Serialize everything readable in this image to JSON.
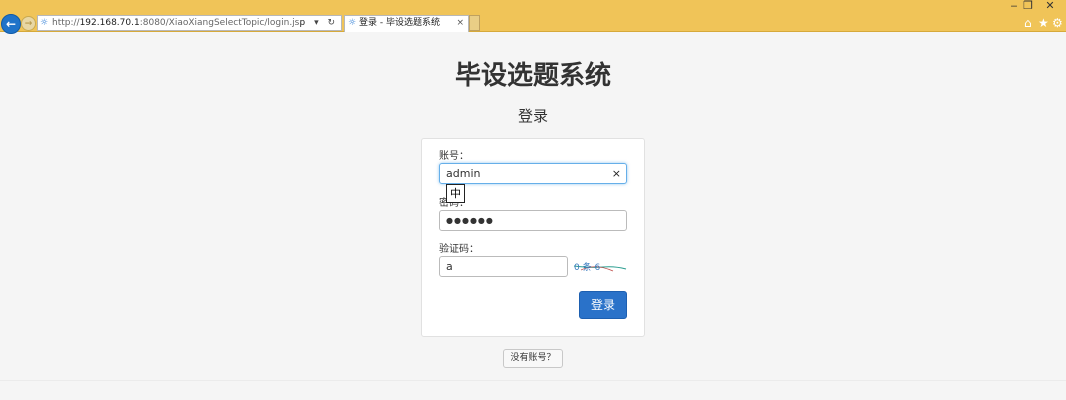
{
  "browser": {
    "url_prefix": "http://",
    "url_host": "192.168.70.1",
    "url_rest": ":8080/XiaoXiangSelectTopic/login.jsp",
    "tab_title": "登录 - 毕设选题系统",
    "tab_close": "×",
    "address_tools": "ρ ▾ ↻",
    "win_min": "‒",
    "win_restore": "❐",
    "win_close": "✕"
  },
  "page": {
    "system_title": "毕设选题系统",
    "subtitle": "登录"
  },
  "form": {
    "account_label": "账号：",
    "account_value": "admin",
    "account_clear": "×",
    "ime_indicator": "中",
    "password_label": "密码：",
    "password_value": "●●●●●●",
    "captcha_label": "验证码：",
    "captcha_value": "a",
    "captcha_text": "0 条 6",
    "login_button": "登录"
  },
  "register_button": "没有账号？",
  "icons": {
    "back": "back-arrow-icon",
    "forward": "forward-arrow-icon",
    "home": "home-icon",
    "favorites": "star-icon",
    "settings": "gear-icon"
  },
  "colors": {
    "chrome": "#f0c458",
    "primary_button": "#2a72c9",
    "focus_border": "#66afe9"
  }
}
